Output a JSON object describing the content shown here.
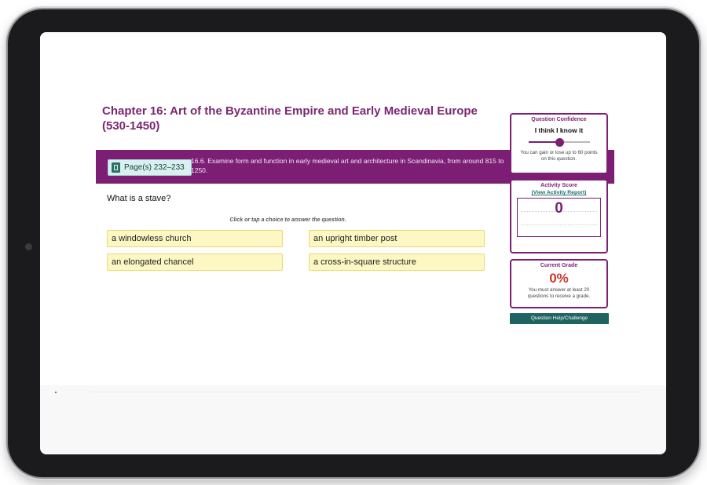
{
  "chapter": {
    "title": "Chapter 16: Art of the Byzantine Empire and Early Medieval Europe (530-1450)"
  },
  "objective": {
    "pages_label": "Page(s) 232–233",
    "text": "16.6. Examine form and function in early medieval art and architecture in Scandinavia, from around 815 to 1250."
  },
  "question": {
    "prompt": "What is a stave?",
    "instruction": "Click or tap a choice to answer the question.",
    "choices": [
      "a windowless church",
      "an upright timber post",
      "an elongated chancel",
      "a cross-in-square structure"
    ]
  },
  "confidence": {
    "heading": "Question Confidence",
    "value_label": "I think I know it",
    "level": 0.5,
    "note": "You can gain or lose up to 60 points on this question."
  },
  "activity": {
    "heading": "Activity Score",
    "link": "(View Activity Report)",
    "score": "0"
  },
  "grade": {
    "heading": "Current Grade",
    "value": "0%",
    "note": "You must answer at least 20 questions to receive a grade."
  },
  "help_button": "Question Help/Challenge",
  "colors": {
    "brand_purple": "#7c1f74",
    "answer_yellow": "#fdf7c4",
    "grade_red": "#c8382c",
    "teal": "#1f6460"
  },
  "icons": {
    "book": "book-icon"
  }
}
